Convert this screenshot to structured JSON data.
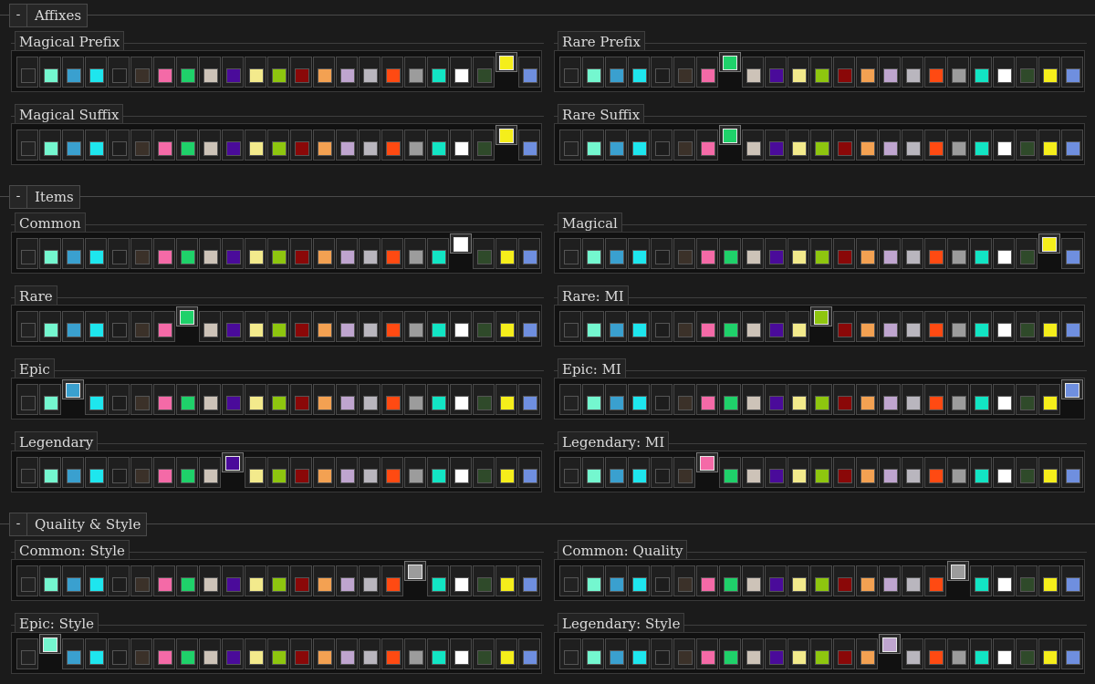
{
  "palette": [
    {
      "name": "charcoal",
      "hex": "#222222"
    },
    {
      "name": "aquamarine",
      "hex": "#74f7cf"
    },
    {
      "name": "steel-blue",
      "hex": "#3aa0cf"
    },
    {
      "name": "cyan",
      "hex": "#1ee6ee"
    },
    {
      "name": "dark-gray",
      "hex": "#1d1d1d"
    },
    {
      "name": "dark-brown",
      "hex": "#3b3129"
    },
    {
      "name": "pink",
      "hex": "#f46aa7"
    },
    {
      "name": "green",
      "hex": "#1fd16a"
    },
    {
      "name": "beige",
      "hex": "#cdc3b8"
    },
    {
      "name": "purple",
      "hex": "#4a0b9a"
    },
    {
      "name": "pale-yellow",
      "hex": "#f3ea8c"
    },
    {
      "name": "lime",
      "hex": "#8ec60f"
    },
    {
      "name": "maroon",
      "hex": "#8a0808"
    },
    {
      "name": "orange",
      "hex": "#f3a152"
    },
    {
      "name": "lavender",
      "hex": "#bfa5cf"
    },
    {
      "name": "light-gray",
      "hex": "#b9b6be"
    },
    {
      "name": "red-orange",
      "hex": "#ff4a12"
    },
    {
      "name": "gray",
      "hex": "#9c9c9c"
    },
    {
      "name": "turquoise",
      "hex": "#12e5c4"
    },
    {
      "name": "white",
      "hex": "#ffffff"
    },
    {
      "name": "forest-green",
      "hex": "#2f4a2a"
    },
    {
      "name": "yellow",
      "hex": "#f5ee1b"
    },
    {
      "name": "periwinkle",
      "hex": "#6f8fdf"
    }
  ],
  "sections": [
    {
      "label": "Affixes",
      "collapse": "-",
      "panels": [
        {
          "title": "Magical Prefix",
          "selected": 21
        },
        {
          "title": "Rare Prefix",
          "selected": 7
        },
        {
          "title": "Magical Suffix",
          "selected": 21
        },
        {
          "title": "Rare Suffix",
          "selected": 7
        }
      ]
    },
    {
      "label": "Items",
      "collapse": "-",
      "panels": [
        {
          "title": "Common",
          "selected": 19
        },
        {
          "title": "Magical",
          "selected": 21
        },
        {
          "title": "Rare",
          "selected": 7
        },
        {
          "title": "Rare: MI",
          "selected": 11
        },
        {
          "title": "Epic",
          "selected": 2
        },
        {
          "title": "Epic: MI",
          "selected": 22
        },
        {
          "title": "Legendary",
          "selected": 9
        },
        {
          "title": "Legendary: MI",
          "selected": 6
        }
      ]
    },
    {
      "label": "Quality & Style",
      "collapse": "-",
      "panels": [
        {
          "title": "Common: Style",
          "selected": 17
        },
        {
          "title": "Common: Quality",
          "selected": 17
        },
        {
          "title": "Epic: Style",
          "selected": 1
        },
        {
          "title": "Legendary: Style",
          "selected": 14
        }
      ]
    }
  ]
}
